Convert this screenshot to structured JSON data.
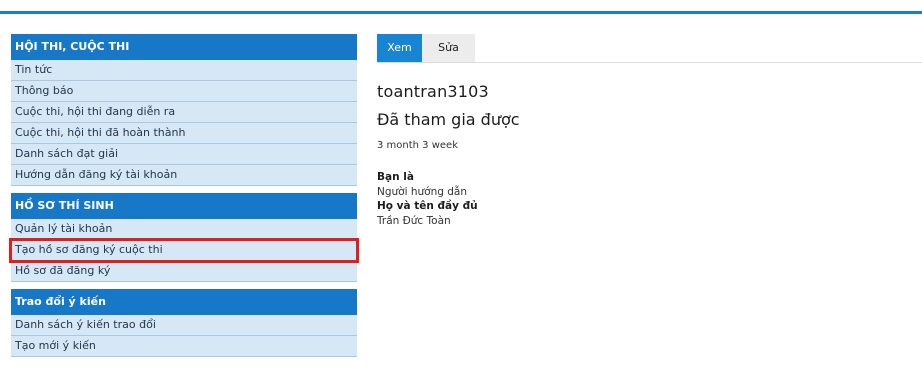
{
  "sidebar": {
    "blocks": [
      {
        "title": "HỘI THI, CUỘC THI",
        "items": [
          "Tin tức",
          "Thông báo",
          "Cuộc thi, hội thi đang diễn ra",
          "Cuộc thi, hội thi đã hoàn thành",
          "Danh sách đạt giải",
          "Hướng dẫn đăng ký tài khoản"
        ]
      },
      {
        "title": "HỒ SƠ THÍ SINH",
        "items": [
          "Quản lý tài khoản",
          "Tạo hồ sơ đăng ký cuộc thi",
          "Hồ sơ đã đăng ký"
        ]
      },
      {
        "title": "Trao đổi ý kiến",
        "items": [
          "Danh sách ý kiến trao đổi",
          "Tạo mới ý kiến"
        ]
      }
    ]
  },
  "tabs": {
    "view": "Xem",
    "edit": "Sửa"
  },
  "profile": {
    "username": "toantran3103",
    "member_for_title": "Đã tham gia được",
    "member_for_value": "3 month 3 week",
    "role_label": "Bạn là",
    "role_value": "Người hướng dẫn",
    "fullname_label": "Họ và tên đầy đủ",
    "fullname_value": "Trần Đức Toàn"
  },
  "colors": {
    "accent": "#1878c8",
    "highlight": "#e31c1c",
    "menu_bg": "#d6e8f6"
  }
}
